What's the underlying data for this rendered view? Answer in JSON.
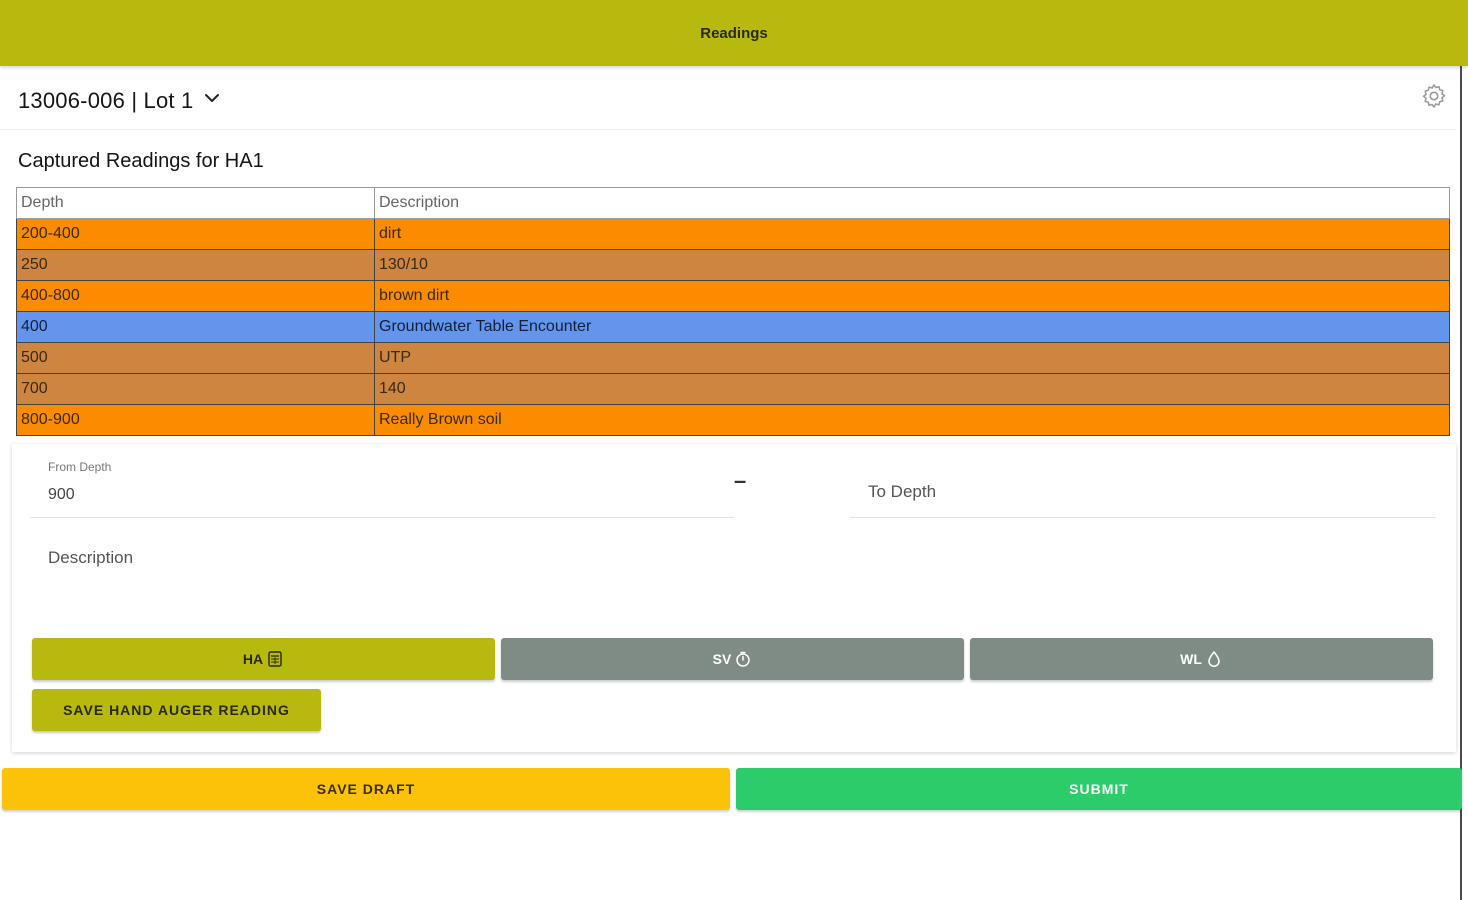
{
  "appbar": {
    "title": "Readings"
  },
  "project": {
    "title": "13006-006 | Lot 1"
  },
  "section": {
    "heading": "Captured Readings for HA1"
  },
  "table": {
    "headers": [
      "Depth",
      "Description"
    ],
    "rows": [
      {
        "depth": "200-400",
        "description": "dirt",
        "color": "#fb8c00"
      },
      {
        "depth": "250",
        "description": "130/10",
        "color": "#cd853f"
      },
      {
        "depth": "400-800",
        "description": "brown dirt",
        "color": "#fb8c00"
      },
      {
        "depth": "400",
        "description": "Groundwater Table Encounter",
        "color": "#6495ed"
      },
      {
        "depth": "500",
        "description": "UTP",
        "color": "#cd853f"
      },
      {
        "depth": "700",
        "description": "140",
        "color": "#cd853f"
      },
      {
        "depth": "800-900",
        "description": "Really Brown soil",
        "color": "#fb8c00"
      }
    ]
  },
  "form": {
    "from_depth": {
      "label": "From Depth",
      "value": "900"
    },
    "separator": "–",
    "to_depth": {
      "placeholder": "To Depth"
    },
    "description": {
      "placeholder": "Description"
    }
  },
  "modes": {
    "ha": {
      "label": "HA",
      "icon": "calculator-icon"
    },
    "sv": {
      "label": "SV",
      "icon": "timer-icon"
    },
    "wl": {
      "label": "WL",
      "icon": "water-drop-icon"
    }
  },
  "actions": {
    "save_reading": "SAVE HAND AUGER READING",
    "save_draft": "SAVE DRAFT",
    "submit": "SUBMIT"
  },
  "colors": {
    "primary": "#b8b90f",
    "neutral": "#7f8c85",
    "draft": "#fcc20a",
    "submit": "#2dcc6b"
  }
}
